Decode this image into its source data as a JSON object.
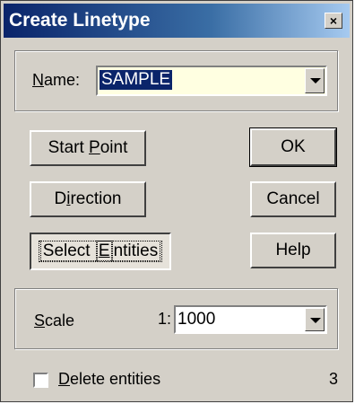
{
  "window": {
    "title": "Create Linetype",
    "close_glyph": "×"
  },
  "name_group": {
    "label_accel": "N",
    "label_rest": "ame:",
    "value": "SAMPLE"
  },
  "buttons": {
    "start_point_pre": "Start ",
    "start_point_accel": "P",
    "start_point_post": "oint",
    "direction_pre": "D",
    "direction_accel": "i",
    "direction_post": "rection",
    "select_entities_pre": "Select ",
    "select_entities_accel": "E",
    "select_entities_post": "ntities",
    "ok": "OK",
    "cancel": "Cancel",
    "help": "Help"
  },
  "scale_group": {
    "label_accel": "S",
    "label_rest": "cale",
    "ratio_prefix": "1:",
    "value": "1000"
  },
  "delete_entities": {
    "label_accel": "D",
    "label_rest": "elete entities",
    "checked": false,
    "count": "3"
  },
  "colors": {
    "face": "#d4d0c8",
    "title_start": "#0a246a",
    "title_end": "#a6caf0",
    "highlight": "#0a246a",
    "field_bg": "#ffffe1"
  }
}
